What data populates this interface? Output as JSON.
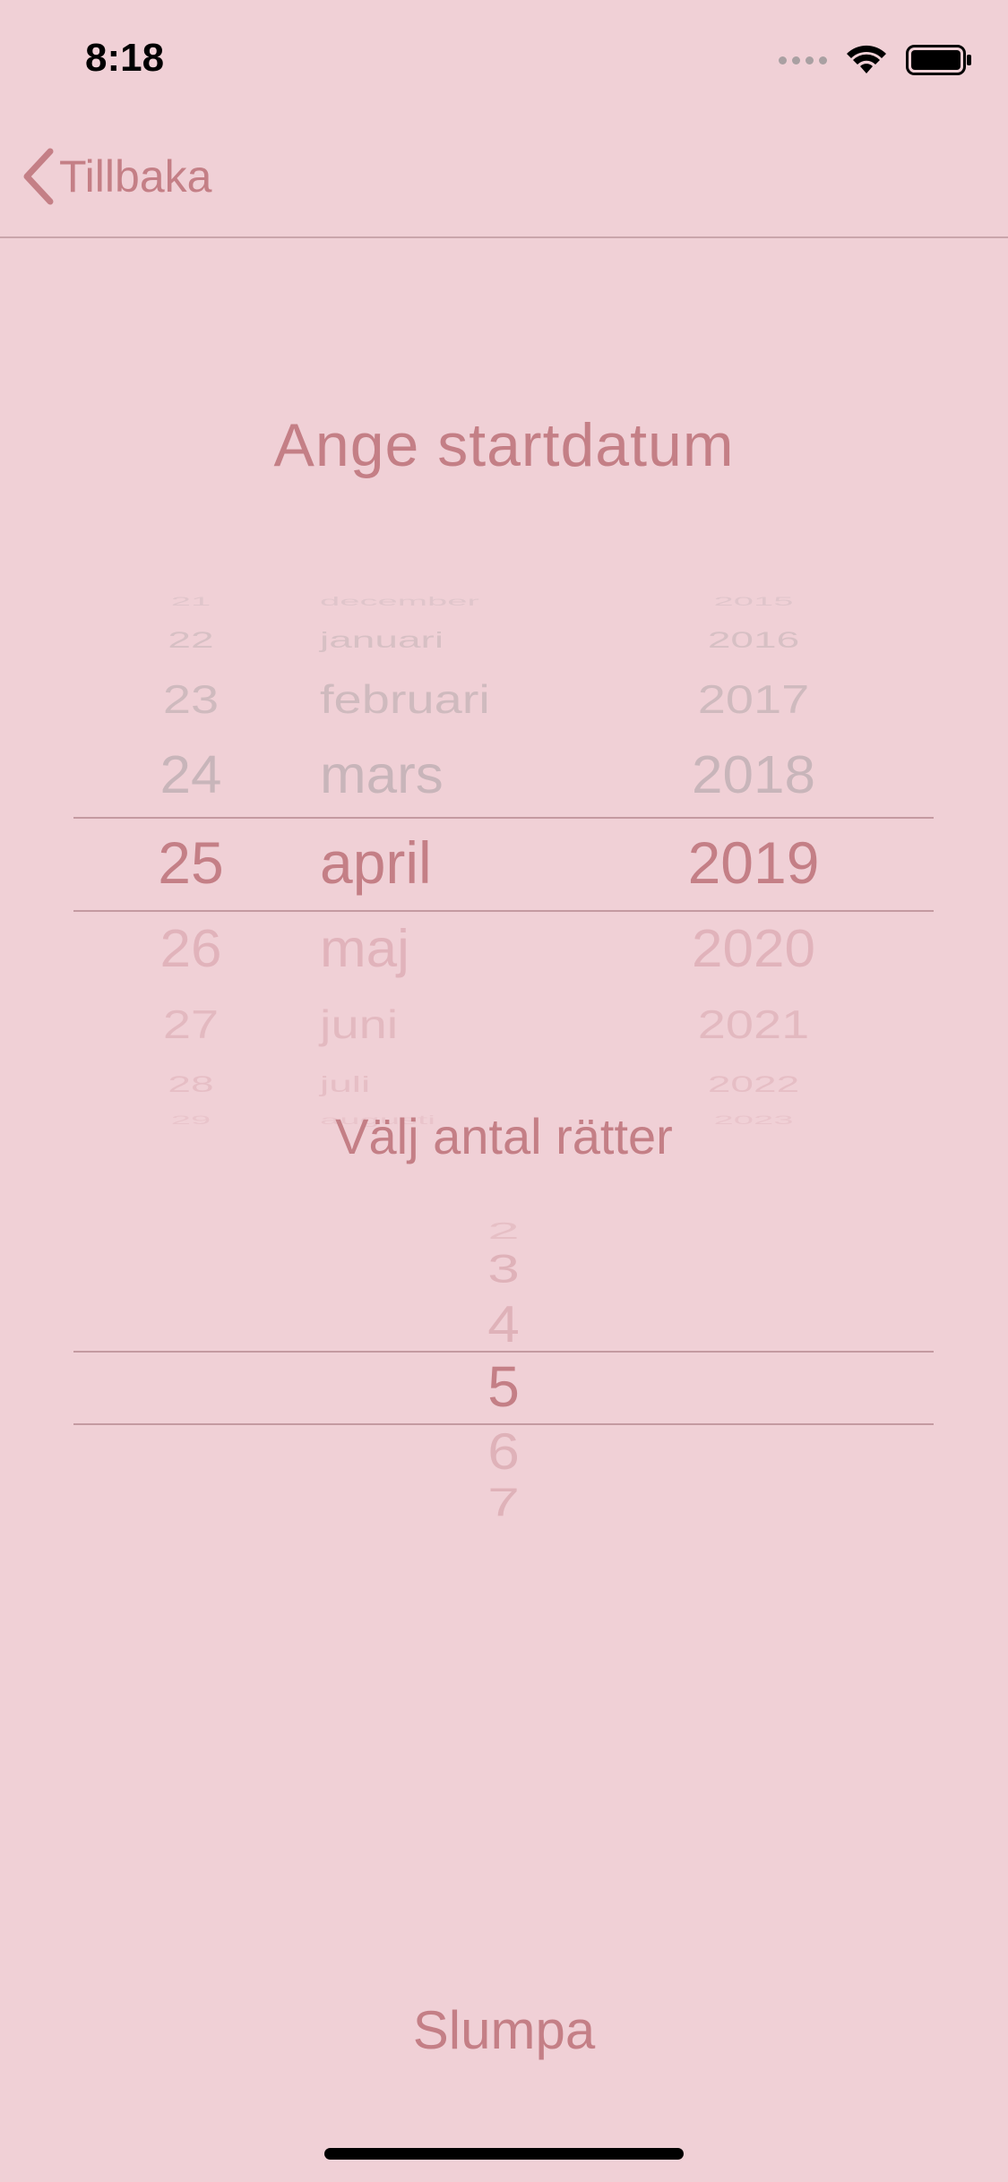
{
  "status_bar": {
    "time": "8:18"
  },
  "nav": {
    "back_label": "Tillbaka"
  },
  "date_section": {
    "title": "Ange startdatum"
  },
  "date_picker": {
    "days": [
      "21",
      "22",
      "23",
      "24",
      "25",
      "26",
      "27",
      "28",
      "29"
    ],
    "months": [
      "december",
      "januari",
      "februari",
      "mars",
      "april",
      "maj",
      "juni",
      "juli",
      "augusti"
    ],
    "years": [
      "2015",
      "2016",
      "2017",
      "2018",
      "2019",
      "2020",
      "2021",
      "2022",
      "2023"
    ],
    "selected": {
      "day": "25",
      "month": "april",
      "year": "2019"
    }
  },
  "count_section": {
    "title": "Välj antal rätter"
  },
  "count_picker": {
    "values": [
      "2",
      "3",
      "4",
      "5",
      "6",
      "7"
    ],
    "selected": "5"
  },
  "actions": {
    "randomize_label": "Slumpa"
  },
  "colors": {
    "background": "#f0d0d6",
    "accent": "#c47f86",
    "faded": "#c9b9bd"
  }
}
